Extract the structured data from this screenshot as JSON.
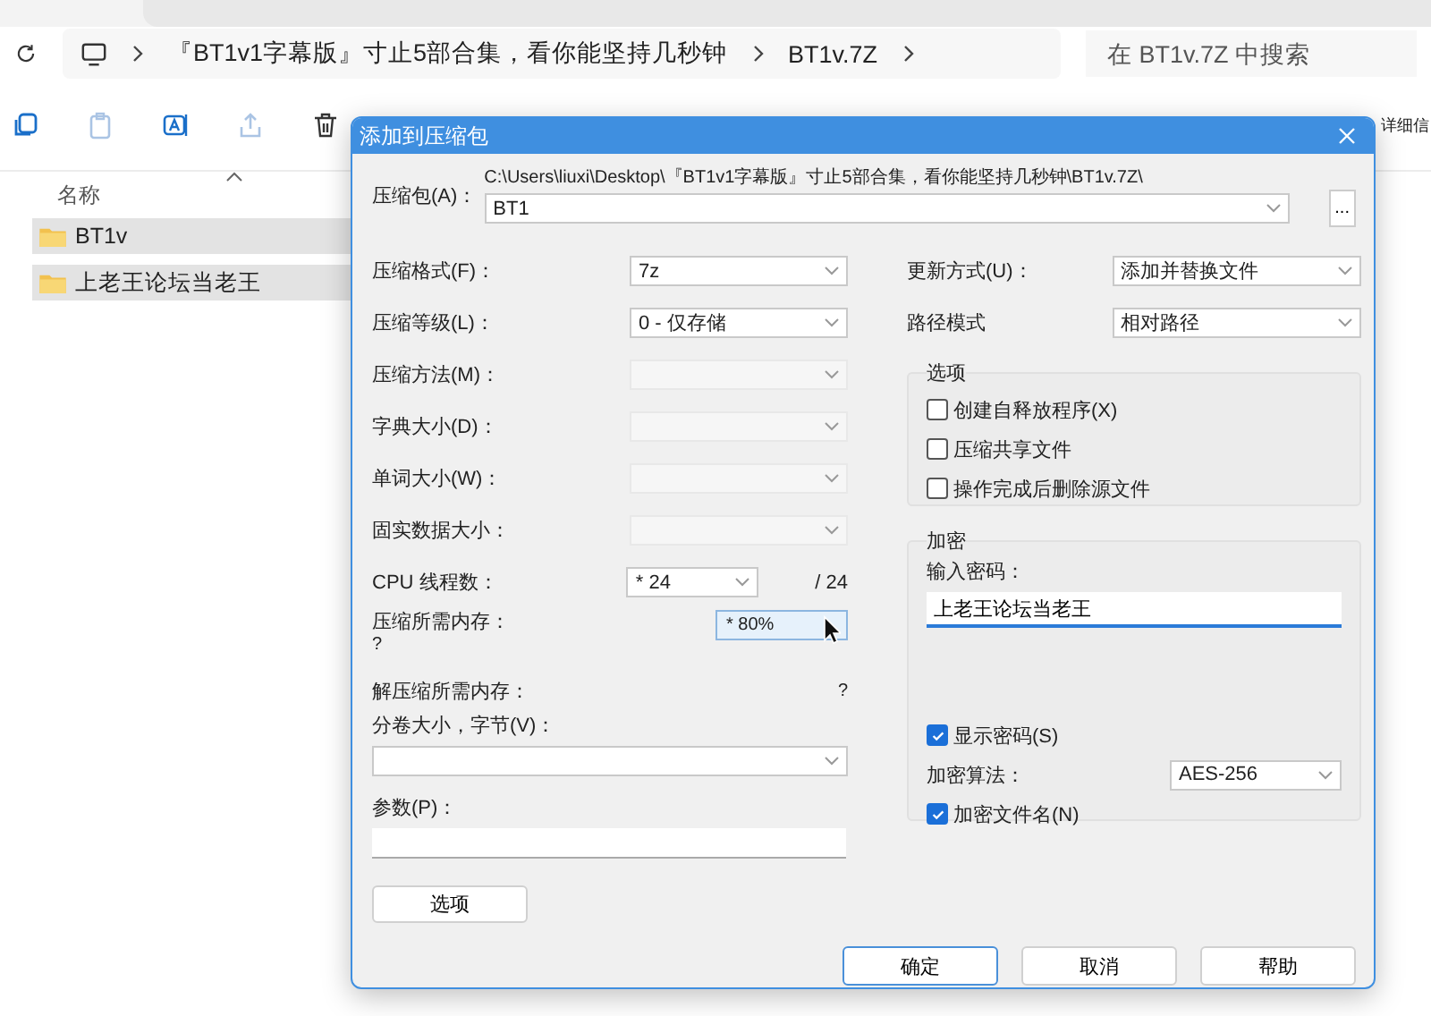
{
  "explorer": {
    "crumbs": [
      "『BT1v1字幕版』寸止5部合集，看你能坚持几秒钟",
      "BT1v.7Z"
    ],
    "search": {
      "placeholder": "在 BT1v.7Z 中搜索"
    },
    "toolbar_text": "详细信",
    "column": "名称",
    "files": [
      {
        "name": "BT1v",
        "selected": true
      },
      {
        "name": "上老王论坛当老王",
        "selected": true
      }
    ]
  },
  "dialog": {
    "title": "添加到压缩包",
    "archive": {
      "label": "压缩包(A)：",
      "path": "C:\\Users\\liuxi\\Desktop\\『BT1v1字幕版』寸止5部合集，看你能坚持几秒钟\\BT1v.7Z\\",
      "value": "BT1",
      "browse": "..."
    },
    "settings": [
      {
        "label": "压缩格式(F)：",
        "value": "7z",
        "disabled": false
      },
      {
        "label": "压缩等级(L)：",
        "value": "0 - 仅存储",
        "disabled": false
      },
      {
        "label": "压缩方法(M)：",
        "disabled": true
      },
      {
        "label": "字典大小(D)：",
        "disabled": true
      },
      {
        "label": "单词大小(W)：",
        "disabled": true
      },
      {
        "label": "固实数据大小：",
        "disabled": true
      }
    ],
    "cpu_threads": {
      "label": "CPU 线程数：",
      "value": "* 24",
      "total": "/ 24"
    },
    "compress_memory": {
      "label": "压缩所需内存：",
      "reading": "?",
      "value": "* 80%"
    },
    "decompress_memory": {
      "label": "解压缩所需内存：",
      "reading": "?"
    },
    "volume": {
      "label": "分卷大小，字节(V)："
    },
    "parameters": {
      "label": "参数(P)："
    },
    "options_button": "选项",
    "right_settings": [
      {
        "label": "更新方式(U)：",
        "value": "添加并替换文件"
      },
      {
        "label": "路径模式",
        "value": "相对路径"
      }
    ],
    "options_group": {
      "title": "选项",
      "items": [
        {
          "label": "创建自释放程序(X)",
          "checked": false
        },
        {
          "label": "压缩共享文件",
          "checked": false
        },
        {
          "label": "操作完成后删除源文件",
          "checked": false
        }
      ]
    },
    "encryption": {
      "title": "加密",
      "password_label": "输入密码：",
      "password": "上老王论坛当老王",
      "show_password": {
        "label": "显示密码(S)",
        "checked": true
      },
      "method_label": "加密算法：",
      "method": "AES-256",
      "encrypt_names": {
        "label": "加密文件名(N)",
        "checked": true
      }
    },
    "buttons": [
      {
        "label": "确定",
        "default": true
      },
      {
        "label": "取消",
        "default": false
      },
      {
        "label": "帮助",
        "default": false
      }
    ]
  }
}
